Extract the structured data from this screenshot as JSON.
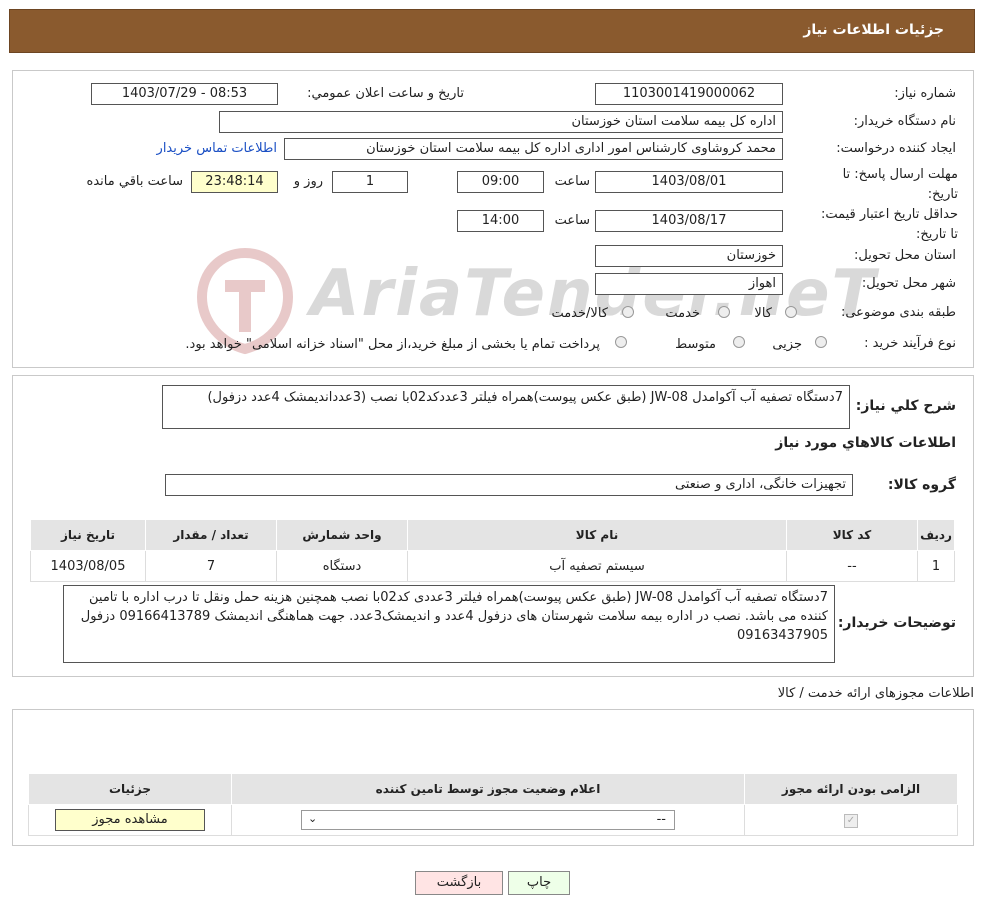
{
  "header": {
    "title": "جزئیات اطلاعات نیاز"
  },
  "watermark": {
    "text": "AriaTender.neT"
  },
  "fields": {
    "need_number_label": "شماره نیاز:",
    "need_number": "1103001419000062",
    "announce_label": "تاریخ و ساعت اعلان عمومي:",
    "announce_value": "1403/07/29 - 08:53",
    "buyer_org_label": "نام دستگاه خريدار:",
    "buyer_org": "اداره کل بیمه سلامت استان خوزستان",
    "requester_label": "ايجاد کننده درخواست:",
    "requester": "محمد کروشاوی کارشناس امور اداری اداره کل بیمه سلامت استان خوزستان",
    "contact_link": "اطلاعات تماس خریدار",
    "deadline_label": "مهلت ارسال پاسخ: تا تاریخ:",
    "deadline_date": "1403/08/01",
    "time_label": "ساعت",
    "deadline_time": "09:00",
    "days": "1",
    "days_label": "روز و",
    "remaining_time": "23:48:14",
    "remaining_label": "ساعت باقي مانده",
    "validity_label": "حداقل تاريخ اعتبار قيمت: تا تاریخ:",
    "validity_date": "1403/08/17",
    "validity_time": "14:00",
    "province_label": "استان محل تحویل:",
    "province": "خوزستان",
    "city_label": "شهر محل تحویل:",
    "city": "اهواز",
    "category_label": "طبقه بندی موضوعی:",
    "category_options": [
      "کالا",
      "خدمت",
      "کالا/خدمت"
    ],
    "process_label": "نوع فرآیند خرید :",
    "process_options": [
      "جزیی",
      "متوسط"
    ],
    "process_note": "پرداخت تمام یا بخشی از مبلغ خرید،از محل \"اسناد خزانه اسلامی\" خواهد بود."
  },
  "summary": {
    "label": "شرح کلي نياز:",
    "text": "7دستگاه تصفیه آب آکوامدل JW-08 (طبق عکس پیوست)همراه فیلتر 3عددکد02با نصب  (3عدداندیمشک 4عدد دزفول)"
  },
  "goods": {
    "section_title": "اطلاعات کالاهاي مورد نياز",
    "group_label": "گروه کالا:",
    "group_value": "تجهیزات خانگی، اداری و صنعتی",
    "columns": [
      "رديف",
      "کد کالا",
      "نام کالا",
      "واحد شمارش",
      "تعداد / مقدار",
      "تاریخ نیاز"
    ],
    "rows": [
      [
        "1",
        "--",
        "سیستم تصفیه آب",
        "دستگاه",
        "7",
        "1403/08/05"
      ]
    ]
  },
  "buyer_notes": {
    "label": "توضیحات خریدار:",
    "text": "7دستگاه تصفیه آب آکوامدل JW-08 (طبق عکس پیوست)همراه فیلتر 3عددی کد02با نصب همچنین  هزینه حمل ونقل تا درب اداره با تامین کننده می باشد. نصب در اداره بیمه سلامت شهرستان های  دزفول 4عدد و اندیمشک3عدد. جهت هماهنگی اندیمشک 09166413789 دزفول 09163437905"
  },
  "permits": {
    "section_title": "اطلاعات مجوزهای ارائه خدمت / کالا",
    "columns": [
      "الزامی بودن ارائه مجوز",
      "اعلام وضعیت مجوز توسط تامین کننده",
      "جزئیات"
    ],
    "select_value": "--",
    "view_button": "مشاهده مجوز"
  },
  "buttons": {
    "print": "چاپ",
    "back": "بازگشت"
  },
  "colors": {
    "header_bg": "#8a5a2e",
    "link": "#1a4fc4",
    "yellow": "#ffffcc"
  }
}
